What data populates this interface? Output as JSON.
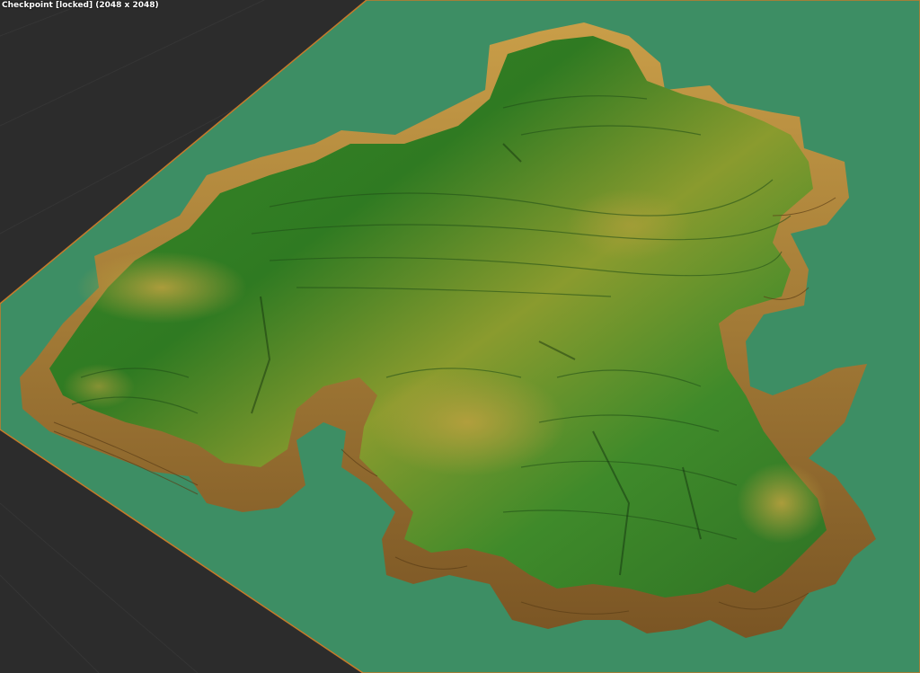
{
  "viewport": {
    "title": "Checkpoint [locked] (2048 x 2048)"
  },
  "colors": {
    "background": "#2c2c2c",
    "ground_plane": "#3d8e64",
    "terrain_high": "#2f7a22",
    "terrain_mid": "#7e9a2c",
    "terrain_low": "#c29b44",
    "cliff_shadow": "#6b4a1e",
    "plane_edge": "#c77a2a"
  }
}
